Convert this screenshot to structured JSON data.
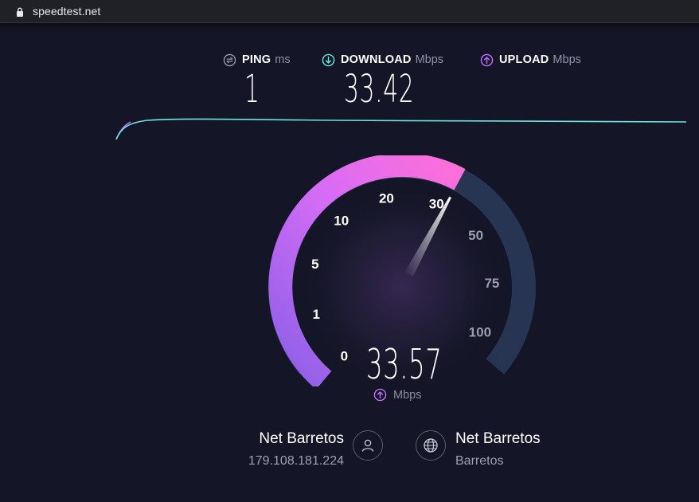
{
  "browser": {
    "url": "speedtest.net"
  },
  "stats": {
    "ping": {
      "title": "PING",
      "unit": "ms",
      "value": "1"
    },
    "download": {
      "title": "DOWNLOAD",
      "unit": "Mbps",
      "value": "33.42"
    },
    "upload": {
      "title": "UPLOAD",
      "unit": "Mbps"
    }
  },
  "gauge": {
    "ticks": [
      "0",
      "1",
      "5",
      "10",
      "20",
      "30",
      "50",
      "75",
      "100"
    ],
    "current_value": "33.57",
    "current_speed": 33.57,
    "unit": "Mbps",
    "colors": {
      "track": "#283552",
      "gradient_start": "#8a5fe6",
      "gradient_end": "#ff6fd8",
      "tick_active": "#ffffff",
      "tick_inactive": "#9a9cb0"
    }
  },
  "provider": {
    "name": "Net Barretos",
    "ip": "179.108.181.224"
  },
  "server": {
    "name": "Net Barretos",
    "location": "Barretos"
  },
  "colors": {
    "background": "#141526",
    "download_accent": "#6de4e4",
    "upload_accent": "#bf71ff"
  }
}
